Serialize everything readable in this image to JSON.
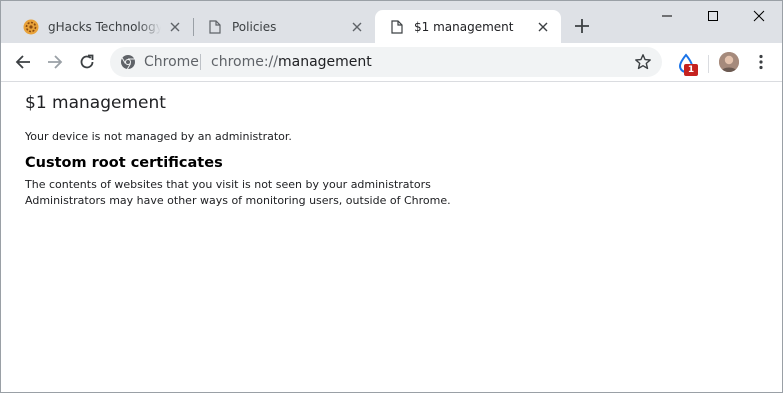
{
  "tabs": [
    {
      "title": "gHacks Technology Ne",
      "favicon": "ghacks-favicon"
    },
    {
      "title": "Policies",
      "favicon": "document-icon"
    },
    {
      "title": "$1 management",
      "favicon": "document-icon",
      "active": true
    }
  ],
  "omnibox": {
    "chip": "Chrome",
    "url_scheme": "chrome://",
    "url_host": "management"
  },
  "extension": {
    "badge": "1"
  },
  "page": {
    "title": "$1 management",
    "status": "Your device is not managed by an administrator.",
    "section_title": "Custom root certificates",
    "lines": [
      "The contents of websites that you visit is not seen by your administrators",
      "Administrators may have other ways of monitoring users, outside of Chrome."
    ]
  },
  "colors": {
    "tabstrip": "#dee1e6",
    "omnibox": "#f1f3f4",
    "badge": "#c5221f"
  }
}
